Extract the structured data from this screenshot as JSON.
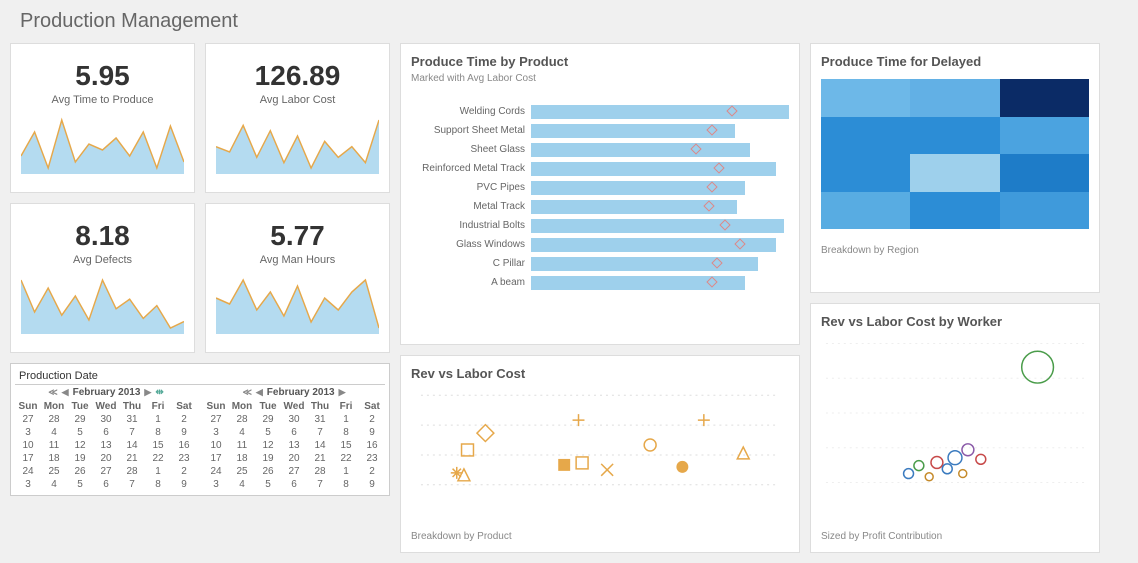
{
  "page_title": "Production Management",
  "kpis": [
    {
      "value": "5.95",
      "label": "Avg Time to Produce",
      "spark": [
        40,
        60,
        30,
        70,
        35,
        50,
        45,
        55,
        40,
        60,
        30,
        65,
        35
      ]
    },
    {
      "value": "126.89",
      "label": "Avg Labor Cost",
      "spark": [
        50,
        45,
        70,
        40,
        65,
        35,
        60,
        30,
        55,
        40,
        50,
        35,
        75
      ]
    },
    {
      "value": "8.18",
      "label": "Avg Defects",
      "spark": [
        60,
        40,
        55,
        38,
        50,
        35,
        60,
        42,
        48,
        36,
        44,
        30,
        34
      ]
    },
    {
      "value": "5.77",
      "label": "Avg Man Hours",
      "spark": [
        55,
        50,
        70,
        45,
        60,
        40,
        65,
        35,
        55,
        45,
        60,
        70,
        30
      ]
    }
  ],
  "produce_time": {
    "title": "Produce Time by Product",
    "subtitle": "Marked with Avg Labor Cost",
    "items": [
      {
        "label": "Welding Cords",
        "bar": 100,
        "mark": 78
      },
      {
        "label": "Support Sheet Metal",
        "bar": 79,
        "mark": 70
      },
      {
        "label": "Sheet Glass",
        "bar": 85,
        "mark": 64
      },
      {
        "label": "Reinforced Metal Track",
        "bar": 95,
        "mark": 73
      },
      {
        "label": "PVC Pipes",
        "bar": 83,
        "mark": 70
      },
      {
        "label": "Metal Track",
        "bar": 80,
        "mark": 69
      },
      {
        "label": "Industrial Bolts",
        "bar": 98,
        "mark": 75
      },
      {
        "label": "Glass Windows",
        "bar": 95,
        "mark": 81
      },
      {
        "label": "C Pillar",
        "bar": 88,
        "mark": 72
      },
      {
        "label": "A beam",
        "bar": 83,
        "mark": 70
      }
    ]
  },
  "rev_vs_labor": {
    "title": "Rev vs Labor Cost",
    "footer": "Breakdown by Product",
    "points": [
      {
        "x": 13,
        "y": 55,
        "shape": "square"
      },
      {
        "x": 18,
        "y": 38,
        "shape": "diamond"
      },
      {
        "x": 10,
        "y": 78,
        "shape": "star"
      },
      {
        "x": 12,
        "y": 80,
        "shape": "triangle"
      },
      {
        "x": 40,
        "y": 70,
        "shape": "squarefill"
      },
      {
        "x": 45,
        "y": 68,
        "shape": "square"
      },
      {
        "x": 44,
        "y": 25,
        "shape": "plus"
      },
      {
        "x": 52,
        "y": 75,
        "shape": "cross"
      },
      {
        "x": 64,
        "y": 50,
        "shape": "circle"
      },
      {
        "x": 73,
        "y": 72,
        "shape": "circlefill"
      },
      {
        "x": 79,
        "y": 25,
        "shape": "plus"
      },
      {
        "x": 90,
        "y": 58,
        "shape": "triangle"
      }
    ]
  },
  "heatmap": {
    "title": "Produce Time for Delayed",
    "footer": "Breakdown by Region",
    "cells": [
      "#6db8e8",
      "#62b0e5",
      "#0b2b66",
      "#2c8dd6",
      "#2c8dd6",
      "#4ba3e0",
      "#2c8dd6",
      "#9ed0ec",
      "#1e7cc8",
      "#58ace2",
      "#2c8dd6",
      "#3f9adb"
    ]
  },
  "bubble": {
    "title": "Rev vs Labor Cost by Worker",
    "footer": "Sized by Profit Contribution",
    "points": [
      {
        "x": 82,
        "y": 18,
        "r": 16,
        "color": "#4a9c4a"
      },
      {
        "x": 32,
        "y": 85,
        "r": 5,
        "color": "#3b7bbf"
      },
      {
        "x": 36,
        "y": 80,
        "r": 5,
        "color": "#4a9c4a"
      },
      {
        "x": 40,
        "y": 87,
        "r": 4,
        "color": "#c58a2a"
      },
      {
        "x": 43,
        "y": 78,
        "r": 6,
        "color": "#c74a4a"
      },
      {
        "x": 47,
        "y": 82,
        "r": 5,
        "color": "#3b7bbf"
      },
      {
        "x": 50,
        "y": 75,
        "r": 7,
        "color": "#3b7bbf"
      },
      {
        "x": 55,
        "y": 70,
        "r": 6,
        "color": "#8a5aa8"
      },
      {
        "x": 60,
        "y": 76,
        "r": 5,
        "color": "#c74a4a"
      },
      {
        "x": 53,
        "y": 85,
        "r": 4,
        "color": "#c58a2a"
      }
    ]
  },
  "calendar": {
    "title": "Production Date",
    "month_label": "February 2013",
    "dow": [
      "Sun",
      "Mon",
      "Tue",
      "Wed",
      "Thu",
      "Fri",
      "Sat"
    ],
    "weeks": [
      [
        "27",
        "28",
        "29",
        "30",
        "31",
        "1",
        "2"
      ],
      [
        "3",
        "4",
        "5",
        "6",
        "7",
        "8",
        "9"
      ],
      [
        "10",
        "11",
        "12",
        "13",
        "14",
        "15",
        "16"
      ],
      [
        "17",
        "18",
        "19",
        "20",
        "21",
        "22",
        "23"
      ],
      [
        "24",
        "25",
        "26",
        "27",
        "28",
        "1",
        "2"
      ],
      [
        "3",
        "4",
        "5",
        "6",
        "7",
        "8",
        "9"
      ]
    ]
  },
  "chart_data": [
    {
      "type": "line",
      "title": "Avg Time to Produce sparkline",
      "values": [
        40,
        60,
        30,
        70,
        35,
        50,
        45,
        55,
        40,
        60,
        30,
        65,
        35
      ]
    },
    {
      "type": "line",
      "title": "Avg Labor Cost sparkline",
      "values": [
        50,
        45,
        70,
        40,
        65,
        35,
        60,
        30,
        55,
        40,
        50,
        35,
        75
      ]
    },
    {
      "type": "line",
      "title": "Avg Defects sparkline",
      "values": [
        60,
        40,
        55,
        38,
        50,
        35,
        60,
        42,
        48,
        36,
        44,
        30,
        34
      ]
    },
    {
      "type": "line",
      "title": "Avg Man Hours sparkline",
      "values": [
        55,
        50,
        70,
        45,
        60,
        40,
        65,
        35,
        55,
        45,
        60,
        70,
        30
      ]
    },
    {
      "type": "bar",
      "title": "Produce Time by Product",
      "categories": [
        "Welding Cords",
        "Support Sheet Metal",
        "Sheet Glass",
        "Reinforced Metal Track",
        "PVC Pipes",
        "Metal Track",
        "Industrial Bolts",
        "Glass Windows",
        "C Pillar",
        "A beam"
      ],
      "series": [
        {
          "name": "Produce Time",
          "values": [
            100,
            79,
            85,
            95,
            83,
            80,
            98,
            95,
            88,
            83
          ]
        },
        {
          "name": "Avg Labor Cost (mark)",
          "values": [
            78,
            70,
            64,
            73,
            70,
            69,
            75,
            81,
            72,
            70
          ]
        }
      ],
      "xlim": [
        0,
        100
      ],
      "subtitle": "Marked with Avg Labor Cost"
    },
    {
      "type": "scatter",
      "title": "Rev vs Labor Cost",
      "series": [
        {
          "name": "Products",
          "x": [
            13,
            18,
            10,
            12,
            40,
            45,
            44,
            52,
            64,
            73,
            79,
            90
          ],
          "y": [
            55,
            38,
            78,
            80,
            70,
            68,
            25,
            75,
            50,
            72,
            25,
            58
          ]
        }
      ],
      "annotations": [
        "Breakdown by Product"
      ]
    },
    {
      "type": "heatmap",
      "title": "Produce Time for Delayed",
      "rows": 4,
      "cols": 3,
      "values": [
        [
          55,
          50,
          95
        ],
        [
          70,
          70,
          60
        ],
        [
          70,
          35,
          80
        ],
        [
          58,
          70,
          65
        ]
      ],
      "annotations": [
        "Breakdown by Region"
      ]
    },
    {
      "type": "scatter",
      "title": "Rev vs Labor Cost by Worker",
      "series": [
        {
          "name": "Workers",
          "x": [
            82,
            32,
            36,
            40,
            43,
            47,
            50,
            55,
            60,
            53
          ],
          "y": [
            18,
            85,
            80,
            87,
            78,
            82,
            75,
            70,
            76,
            85
          ],
          "size": [
            16,
            5,
            5,
            4,
            6,
            5,
            7,
            6,
            5,
            4
          ]
        }
      ],
      "annotations": [
        "Sized by Profit Contribution"
      ]
    }
  ]
}
